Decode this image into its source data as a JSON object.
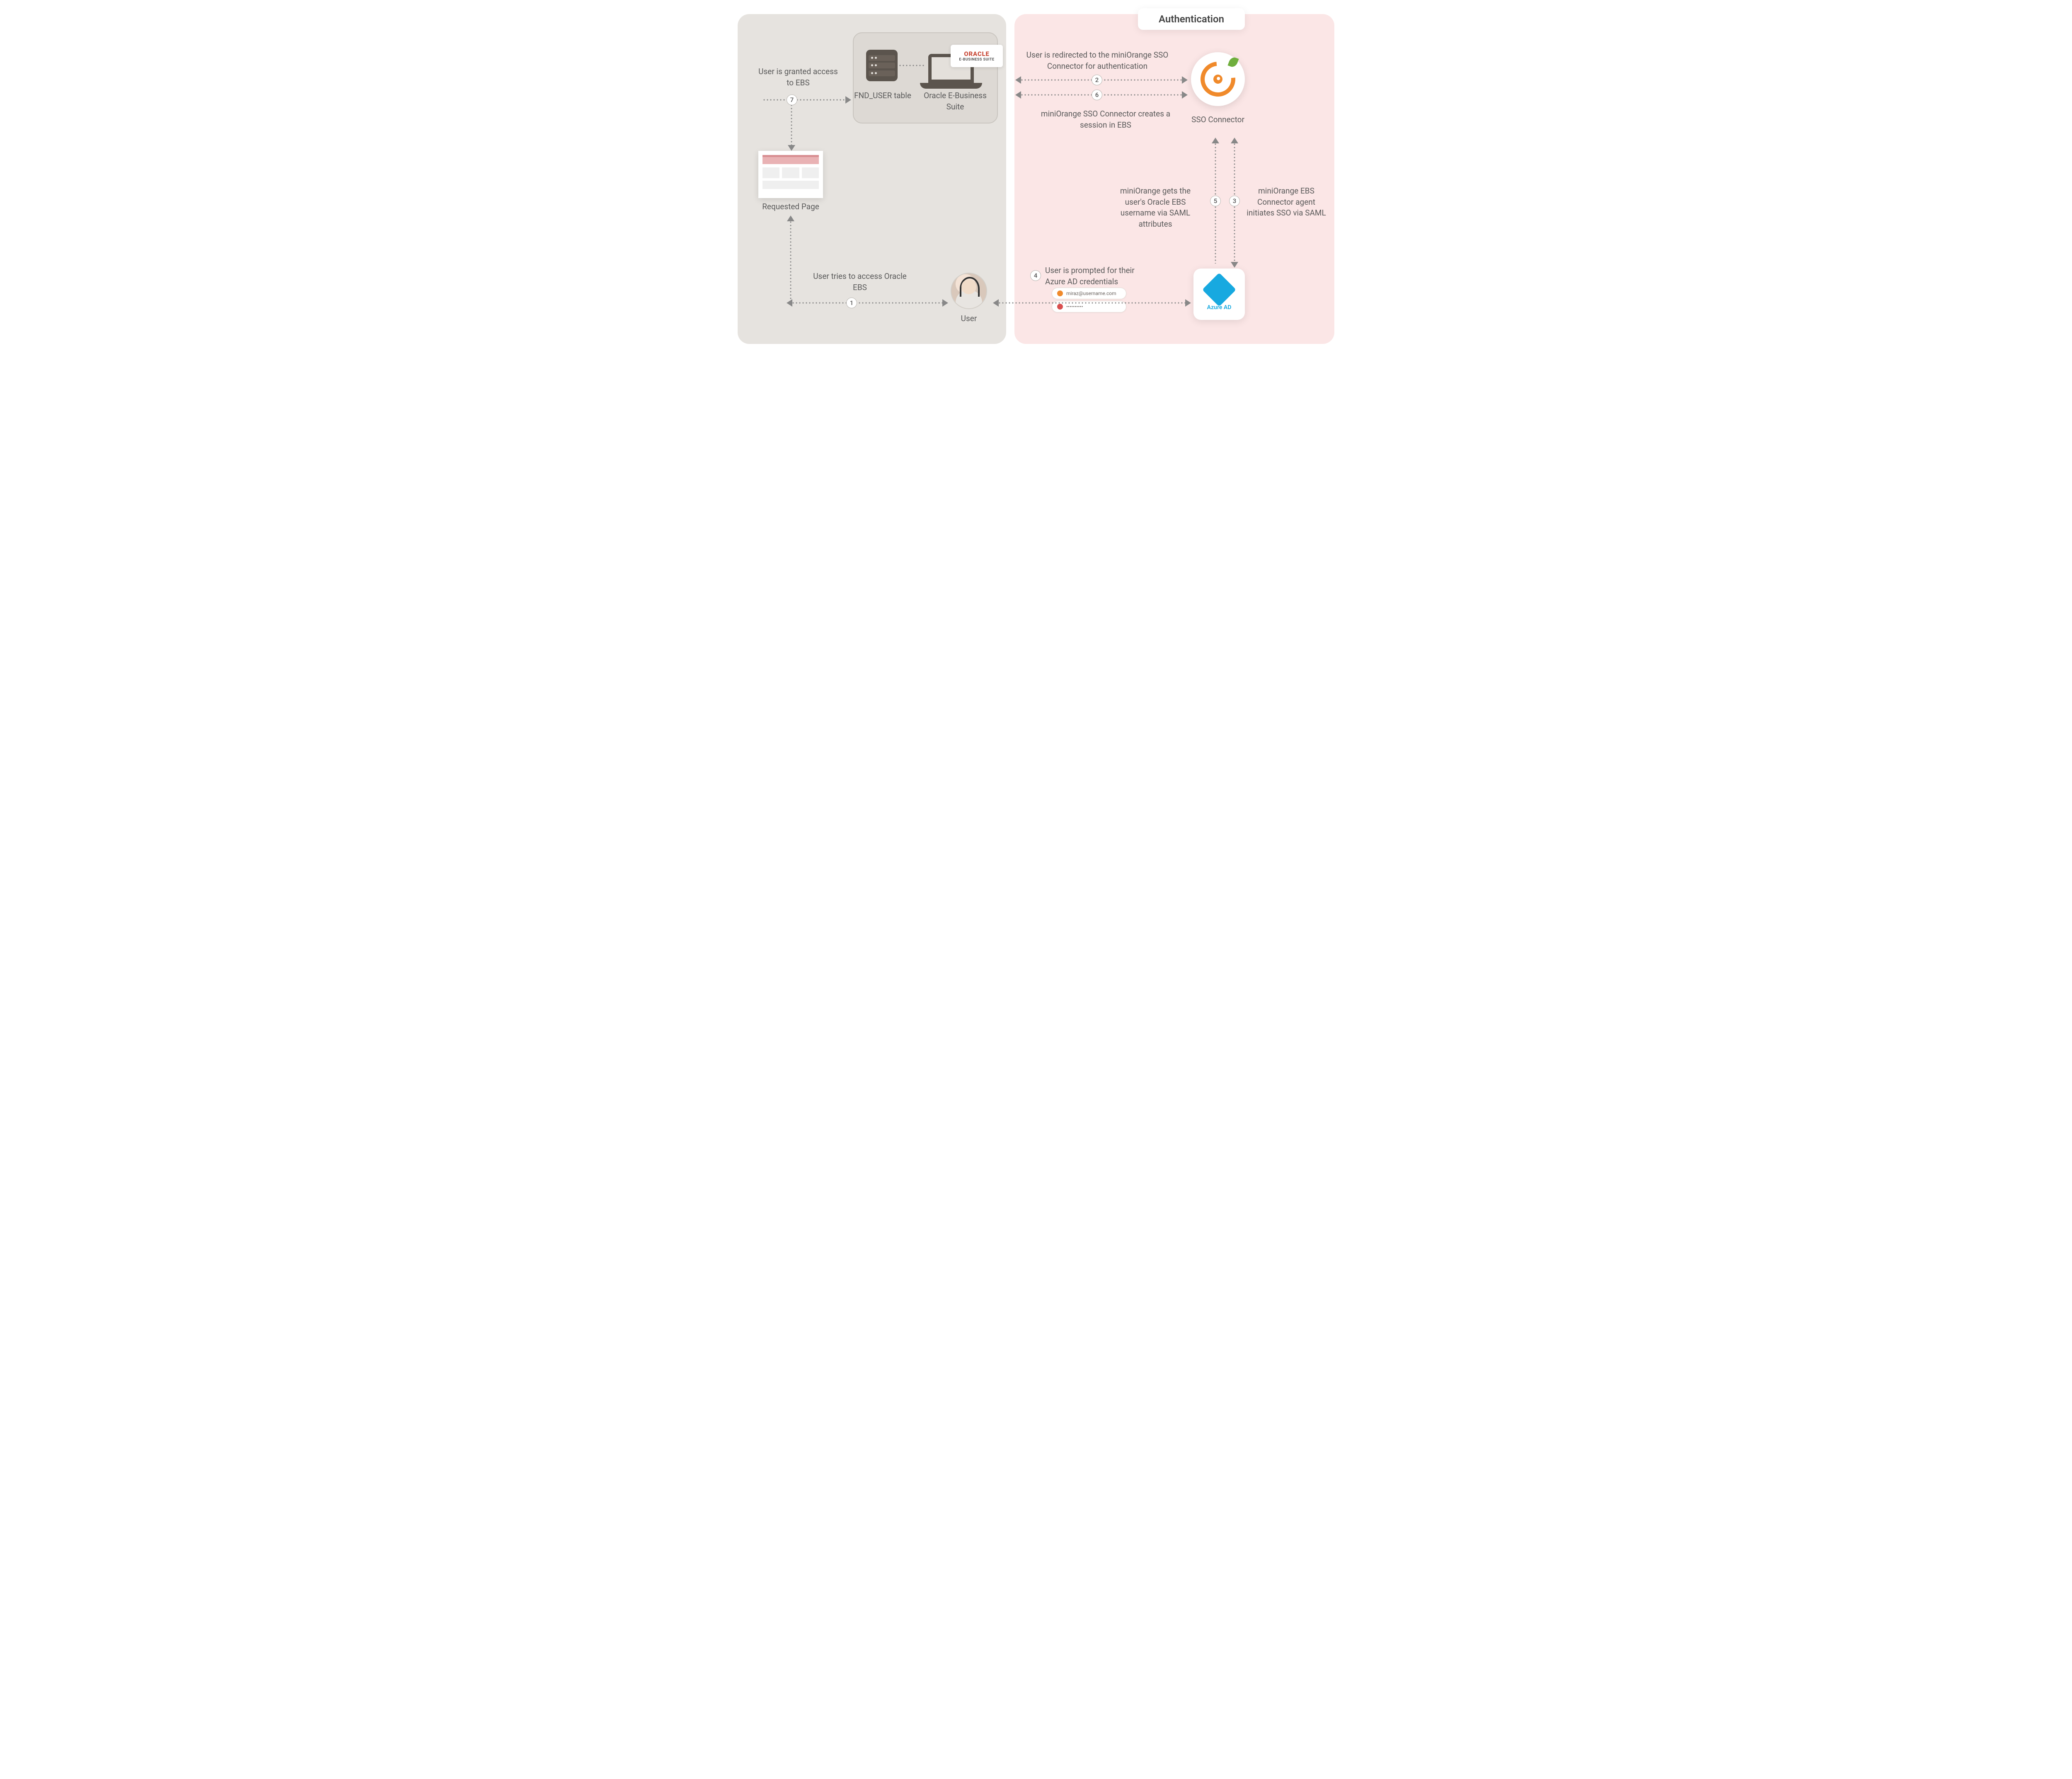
{
  "header": {
    "auth_title": "Authentication"
  },
  "nodes": {
    "fnd_user": "FND_USER table",
    "oracle_ebs": "Oracle E-Business Suite",
    "oracle_tag_brand": "ORACLE",
    "oracle_tag_sub": "E-BUSINESS SUITE",
    "requested_page": "Requested Page",
    "user": "User",
    "sso_connector": "SSO Connector",
    "azure_ad": "Azure AD"
  },
  "steps": {
    "s1": {
      "num": "1",
      "text": "User tries to access Oracle EBS"
    },
    "s2": {
      "num": "2",
      "text": "User is redirected to the miniOrange SSO Connector for authentication"
    },
    "s3": {
      "num": "3",
      "text": "miniOrange EBS Connector agent initiates SSO via SAML"
    },
    "s4": {
      "num": "4",
      "text": "User is prompted for their Azure AD credentials"
    },
    "s5": {
      "num": "5",
      "text": "miniOrange gets the user's Oracle EBS username via SAML attributes"
    },
    "s6": {
      "num": "6",
      "text": "miniOrange SSO Connector creates a session in EBS"
    },
    "s7": {
      "num": "7",
      "text": "User is granted access to EBS"
    }
  },
  "credentials": {
    "username_sample": "miraz@username.com",
    "password_mask": "••••••••••"
  }
}
